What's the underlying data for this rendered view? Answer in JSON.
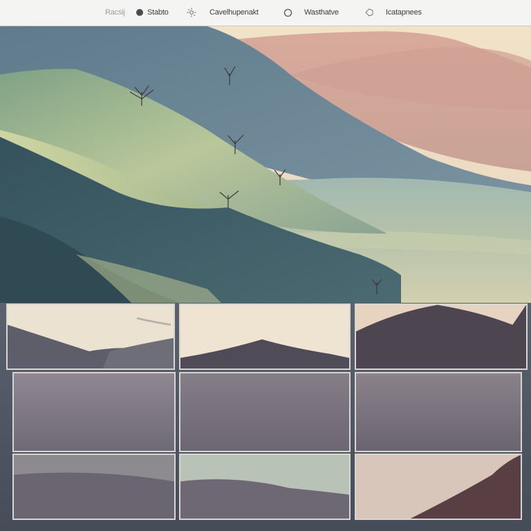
{
  "toolbar": {
    "items": [
      {
        "label": "Racsij",
        "icon": "none"
      },
      {
        "label": "Stabto",
        "icon": "filled-circle-icon"
      },
      {
        "label": "Cavelhupenakt",
        "icon": "sun-icon"
      },
      {
        "label": "Wasthatve",
        "icon": "circle-outline-icon"
      },
      {
        "label": "Icatapnees",
        "icon": "tag-icon"
      }
    ]
  },
  "palette": {
    "toolbar_bg": "#f4f4f2",
    "grid_bg": "#4e5562",
    "thumb_border": "#d7d6d2",
    "sky": "#efe0c6",
    "rose_mountain": "#c99c94",
    "teal_hill": "#3e5b66",
    "mist": "#a7b7ac"
  },
  "gallery": {
    "rows": 3,
    "cols": 3
  }
}
